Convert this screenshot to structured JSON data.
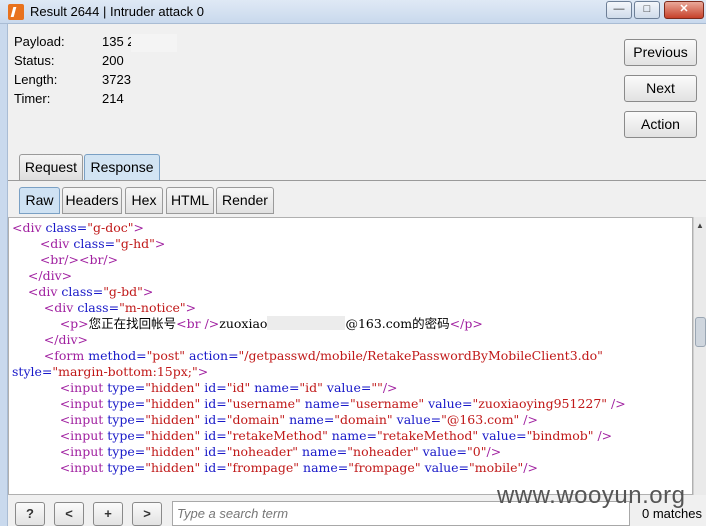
{
  "window": {
    "title": "Result 2644 | Intruder attack 0",
    "min_label": "—",
    "max_label": "□",
    "close_label": "✕"
  },
  "info": {
    "payload_label": "Payload:",
    "payload_value": "135          25",
    "status_label": "Status:",
    "status_value": "200",
    "length_label": "Length:",
    "length_value": "3723",
    "timer_label": "Timer:",
    "timer_value": "214"
  },
  "buttons": {
    "previous": "Previous",
    "next": "Next",
    "action": "Action"
  },
  "tabs": {
    "request": "Request",
    "response": "Response"
  },
  "subtabs": {
    "raw": "Raw",
    "headers": "Headers",
    "hex": "Hex",
    "html": "HTML",
    "render": "Render"
  },
  "code_lines": [
    {
      "indent": 0,
      "parts": [
        [
          "t",
          "<div "
        ],
        [
          "a",
          "class="
        ],
        [
          "v",
          "\"g-doc\""
        ],
        [
          "t",
          ">"
        ]
      ]
    },
    {
      "indent": 7,
      "parts": [
        [
          "t",
          "<div "
        ],
        [
          "a",
          "class="
        ],
        [
          "v",
          "\"g-hd\""
        ],
        [
          "t",
          ">"
        ]
      ]
    },
    {
      "indent": 7,
      "parts": [
        [
          "t",
          "<br/><br/>"
        ]
      ]
    },
    {
      "indent": 4,
      "parts": [
        [
          "t",
          "</div>"
        ]
      ]
    },
    {
      "indent": 4,
      "parts": [
        [
          "t",
          "<div "
        ],
        [
          "a",
          "class="
        ],
        [
          "v",
          "\"g-bd\""
        ],
        [
          "t",
          ">"
        ]
      ]
    },
    {
      "indent": 8,
      "parts": [
        [
          "t",
          "<div "
        ],
        [
          "a",
          "class="
        ],
        [
          "v",
          "\"m-notice\""
        ],
        [
          "t",
          ">"
        ]
      ]
    },
    {
      "indent": 12,
      "parts": [
        [
          "t",
          "<p>"
        ],
        [
          "x",
          "您正在找回帐号"
        ],
        [
          "t",
          "<br />"
        ],
        [
          "x",
          "zuoxiao"
        ],
        [
          "m",
          ""
        ],
        [
          "x",
          "@163.com的密码"
        ],
        [
          "t",
          "</p>"
        ]
      ]
    },
    {
      "indent": 8,
      "parts": [
        [
          "t",
          "</div>"
        ]
      ]
    },
    {
      "indent": 8,
      "parts": [
        [
          "t",
          "<form "
        ],
        [
          "a",
          "method="
        ],
        [
          "v",
          "\"post\" "
        ],
        [
          "a",
          "action="
        ],
        [
          "v",
          "\"/getpasswd/mobile/RetakePasswordByMobileClient3.do\""
        ]
      ]
    },
    {
      "indent": 0,
      "parts": [
        [
          "a",
          "style="
        ],
        [
          "v",
          "\"margin-bottom:15px;\""
        ],
        [
          "t",
          ">"
        ]
      ]
    },
    {
      "indent": 12,
      "parts": [
        [
          "t",
          "<input "
        ],
        [
          "a",
          "type="
        ],
        [
          "v",
          "\"hidden\" "
        ],
        [
          "a",
          "id="
        ],
        [
          "v",
          "\"id\" "
        ],
        [
          "a",
          "name="
        ],
        [
          "v",
          "\"id\" "
        ],
        [
          "a",
          "value="
        ],
        [
          "v",
          "\"\""
        ],
        [
          "t",
          "/>"
        ]
      ]
    },
    {
      "indent": 12,
      "parts": [
        [
          "t",
          "<input "
        ],
        [
          "a",
          "type="
        ],
        [
          "v",
          "\"hidden\" "
        ],
        [
          "a",
          "id="
        ],
        [
          "v",
          "\"username\" "
        ],
        [
          "a",
          "name="
        ],
        [
          "v",
          "\"username\" "
        ],
        [
          "a",
          "value="
        ],
        [
          "v",
          "\"zuoxiaoying951227\" "
        ],
        [
          "t",
          "/>"
        ]
      ]
    },
    {
      "indent": 12,
      "parts": [
        [
          "t",
          "<input "
        ],
        [
          "a",
          "type="
        ],
        [
          "v",
          "\"hidden\" "
        ],
        [
          "a",
          "id="
        ],
        [
          "v",
          "\"domain\" "
        ],
        [
          "a",
          "name="
        ],
        [
          "v",
          "\"domain\" "
        ],
        [
          "a",
          "value="
        ],
        [
          "v",
          "\"@163.com\" "
        ],
        [
          "t",
          "/>"
        ]
      ]
    },
    {
      "indent": 12,
      "parts": [
        [
          "t",
          "<input "
        ],
        [
          "a",
          "type="
        ],
        [
          "v",
          "\"hidden\" "
        ],
        [
          "a",
          "id="
        ],
        [
          "v",
          "\"retakeMethod\" "
        ],
        [
          "a",
          "name="
        ],
        [
          "v",
          "\"retakeMethod\" "
        ],
        [
          "a",
          "value="
        ],
        [
          "v",
          "\"bindmob\" "
        ],
        [
          "t",
          "/>"
        ]
      ]
    },
    {
      "indent": 12,
      "parts": [
        [
          "t",
          "<input "
        ],
        [
          "a",
          "type="
        ],
        [
          "v",
          "\"hidden\" "
        ],
        [
          "a",
          "id="
        ],
        [
          "v",
          "\"noheader\" "
        ],
        [
          "a",
          "name="
        ],
        [
          "v",
          "\"noheader\" "
        ],
        [
          "a",
          "value="
        ],
        [
          "v",
          "\"0\""
        ],
        [
          "t",
          "/>"
        ]
      ]
    },
    {
      "indent": 12,
      "parts": [
        [
          "t",
          "<input "
        ],
        [
          "a",
          "type="
        ],
        [
          "v",
          "\"hidden\" "
        ],
        [
          "a",
          "id="
        ],
        [
          "v",
          "\"frompage\" "
        ],
        [
          "a",
          "name="
        ],
        [
          "v",
          "\"frompage\" "
        ],
        [
          "a",
          "value="
        ],
        [
          "v",
          "\"mobile\""
        ],
        [
          "t",
          "/>"
        ]
      ]
    }
  ],
  "bottom": {
    "help_label": "?",
    "prev_label": "<",
    "add_label": "+",
    "next_label": ">",
    "search_placeholder": "Type a search term",
    "matches_text": "0 matches"
  },
  "watermark": "www.wooyun.org",
  "colors": {
    "tag": "#a020a0",
    "attribute": "#1818c8",
    "value": "#c01818",
    "active_tab": "#d2e4f3"
  }
}
